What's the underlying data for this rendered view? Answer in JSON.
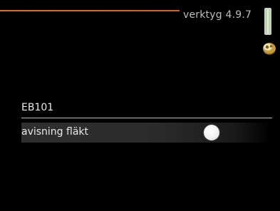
{
  "header": {
    "menu_path": "verktyg 4.9.7"
  },
  "content": {
    "section_title": "EB101",
    "setting": {
      "label": "avisning fläkt",
      "state": "off"
    }
  },
  "icons": {
    "status_bar": "status-bar-icon",
    "helper": "helper-icon"
  },
  "colors": {
    "accent": "#f26a00",
    "background": "#000000",
    "text": "#e9e9e9"
  }
}
